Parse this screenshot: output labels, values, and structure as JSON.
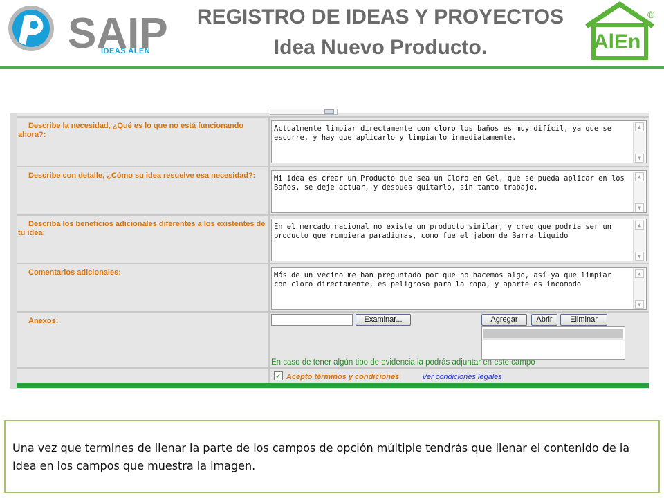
{
  "header": {
    "saip_logo_text": "SAIP",
    "saip_logo_subtitle": "IDEAS ALEN",
    "title_line1": "REGISTRO DE IDEAS Y PROYECTOS",
    "title_line2": "Idea Nuevo Producto.",
    "alen_logo_text": "AlEn",
    "alen_logo_mark": "®",
    "accent_color": "#4caf50",
    "saip_blue": "#1aa0d8",
    "saip_gray": "#8a8a8a"
  },
  "form": {
    "rows": [
      {
        "label": "Describe la necesidad, ¿Qué es lo que no está funcionando ahora?:",
        "value": "Actualmente limpiar directamente con cloro los baños es muy difícil, ya que se escurre, y hay que aplicarlo y limpiarlo inmediatamente."
      },
      {
        "label": "Describe con detalle, ¿Cómo su idea resuelve esa necesidad?:",
        "value": "Mi idea es crear un Producto que sea un Cloro en Gel, que se pueda aplicar en los Baños, se deje actuar, y despues quitarlo, sin tanto trabajo."
      },
      {
        "label": "Describa los beneficios adicionales diferentes a los existentes de tu idea:",
        "value": "En el mercado nacional no existe un producto similar, y creo que podría ser un producto que rompiera paradigmas, como fue el jabon de Barra liquido"
      },
      {
        "label": "Comentarios adicionales:",
        "value": "Más de un vecino me han preguntado por que no hacemos algo, así ya que limpiar con cloro directamente, es peligroso para la ropa,  y aparte es incomodo"
      }
    ],
    "scroll_up_glyph": "▲",
    "scroll_down_glyph": "▼",
    "anexos": {
      "label": "Anexos:",
      "file_value": "",
      "browse_label": "Examinar...",
      "add_label": "Agregar",
      "open_label": "Abrir",
      "remove_label": "Eliminar",
      "hint": "En caso de tener algún tipo de evidencia la podrás adjuntar en este campo"
    },
    "terms": {
      "checked_glyph": "✓",
      "accept_label": "Acepto términos y condiciones",
      "legal_link": "Ver condiciones legales",
      "checked": true
    },
    "label_color": "#d9740a",
    "hint_color": "#2e8b2e",
    "link_color": "#2233cc"
  },
  "note": {
    "text": "Una vez que termines de llenar la parte de los campos de opción múltiple tendrás que llenar el contenido de la Idea en los campos que muestra la imagen.",
    "border_color": "#a5c36b"
  }
}
